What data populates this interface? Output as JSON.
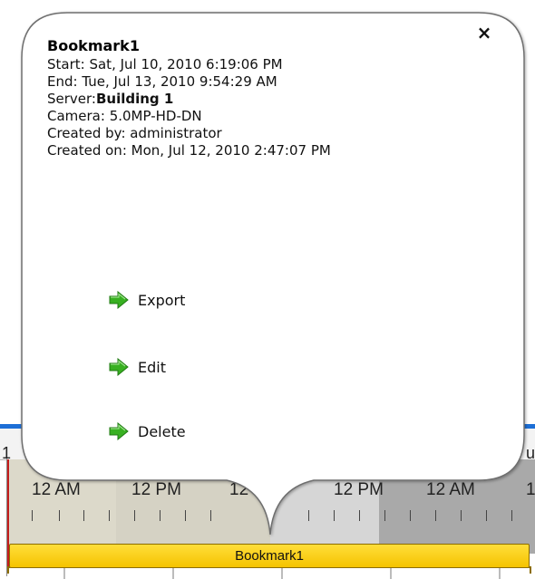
{
  "popup": {
    "title": "Bookmark1",
    "close_label": "×",
    "start_label": "Start: ",
    "start_value": "Sat, Jul 10, 2010 6:19:06 PM",
    "end_label": "End: ",
    "end_value": "Tue, Jul 13, 2010 9:54:29 AM",
    "server_label": "Server:",
    "server_value": "Building 1",
    "camera_label": "Camera: ",
    "camera_value": "5.0MP-HD-DN",
    "created_by_label": "Created by: ",
    "created_by_value": "administrator",
    "created_on_label": "Created on: ",
    "created_on_value": "Mon, Jul 12, 2010 2:47:07 PM",
    "actions": [
      {
        "label": "Export",
        "icon": "green-arrow-icon"
      },
      {
        "label": "Edit",
        "icon": "green-arrow-icon"
      },
      {
        "label": "Delete",
        "icon": "green-arrow-icon"
      }
    ]
  },
  "timeline": {
    "hour_labels": [
      "12 AM",
      "12 PM",
      "12",
      "12 PM",
      "12 AM",
      "1"
    ],
    "left_edge_char": "1",
    "right_edge_char": "u",
    "bookmark_bar_label": "Bookmark1",
    "colors": {
      "accent_blue": "#1d6fd6",
      "bookmark_yellow": "#f5c300",
      "marker_red": "#c41c1c",
      "action_arrow_green": "#38b021"
    }
  }
}
